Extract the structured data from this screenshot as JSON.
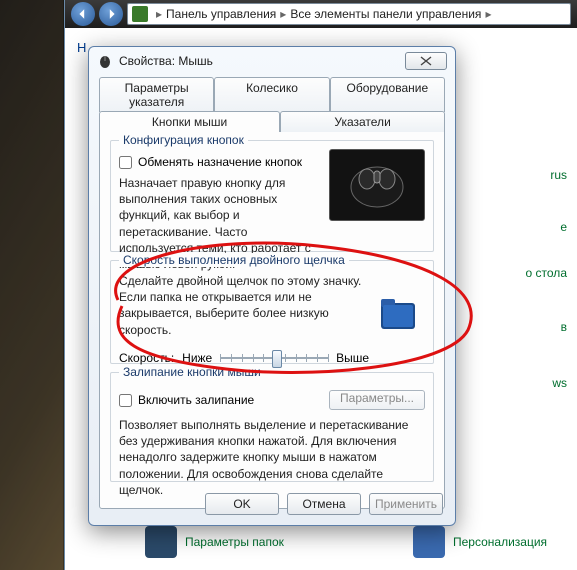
{
  "breadcrumb": {
    "item1": "Панель управления",
    "item2": "Все элементы панели управления"
  },
  "back_heading_fragment": "Н",
  "sidebar_items": [
    {
      "label": "rus"
    },
    {
      "label": "е"
    },
    {
      "label": "о стола"
    },
    {
      "label": "в"
    },
    {
      "label": "ws"
    }
  ],
  "bottom_items": {
    "left": "Параметры папок",
    "right": "Персонализация"
  },
  "dialog": {
    "title": "Свойства: Мышь",
    "tabs_back": [
      "Параметры указателя",
      "Колесико",
      "Оборудование"
    ],
    "tabs_front": [
      "Кнопки мыши",
      "Указатели"
    ],
    "group1": {
      "title": "Конфигурация кнопок",
      "checkbox": "Обменять назначение кнопок",
      "desc": "Назначает правую кнопку для выполнения таких основных функций, как выбор и перетаскивание. Часто используется теми, кто работает с мышью левой рукой."
    },
    "group2": {
      "title": "Скорость выполнения двойного щелчка",
      "desc": "Сделайте двойной щелчок по этому значку. Если папка не открывается или не закрывается, выберите более низкую скорость.",
      "speed_label": "Скорость:",
      "low": "Ниже",
      "high": "Выше"
    },
    "group3": {
      "title": "Залипание кнопки мыши",
      "checkbox": "Включить залипание",
      "params_btn": "Параметры...",
      "desc": "Позволяет выполнять выделение и перетаскивание без удерживания кнопки нажатой. Для включения ненадолго задержите кнопку мыши в нажатом положении. Для освобождения снова сделайте щелчок."
    },
    "buttons": {
      "ok": "OK",
      "cancel": "Отмена",
      "apply": "Применить"
    }
  }
}
